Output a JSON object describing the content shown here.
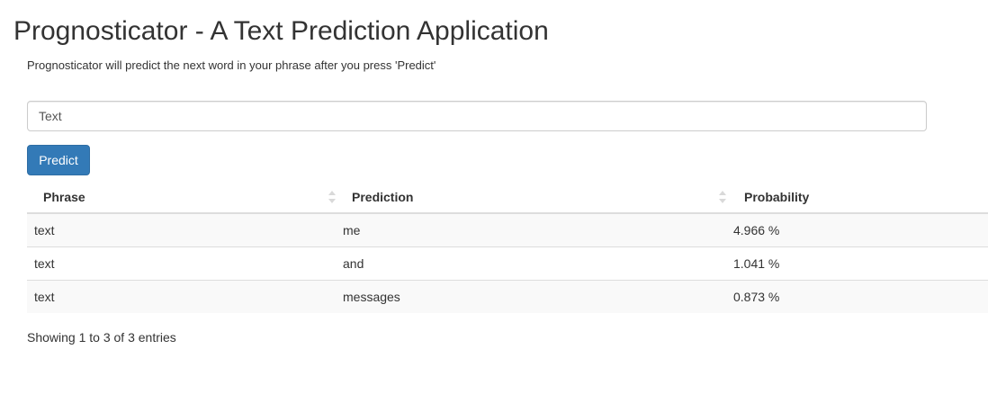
{
  "app": {
    "title": "Prognosticator - A Text Prediction Application",
    "subtitle": "Prognosticator will predict the next word in your phrase after you press 'Predict'"
  },
  "input": {
    "value": "Text",
    "placeholder": ""
  },
  "predict_button": {
    "label": "Predict",
    "color": "#337ab7"
  },
  "table": {
    "columns": [
      "Phrase",
      "Prediction",
      "Probability"
    ],
    "sort_icons": [
      "sort-both-icon",
      "sort-both-icon"
    ],
    "rows": [
      {
        "phrase": "text",
        "prediction": "me",
        "probability": "4.966 %"
      },
      {
        "phrase": "text",
        "prediction": "and",
        "probability": "1.041 %"
      },
      {
        "phrase": "text",
        "prediction": "messages",
        "probability": "0.873 %"
      }
    ],
    "info": "Showing 1 to 3 of 3 entries"
  }
}
